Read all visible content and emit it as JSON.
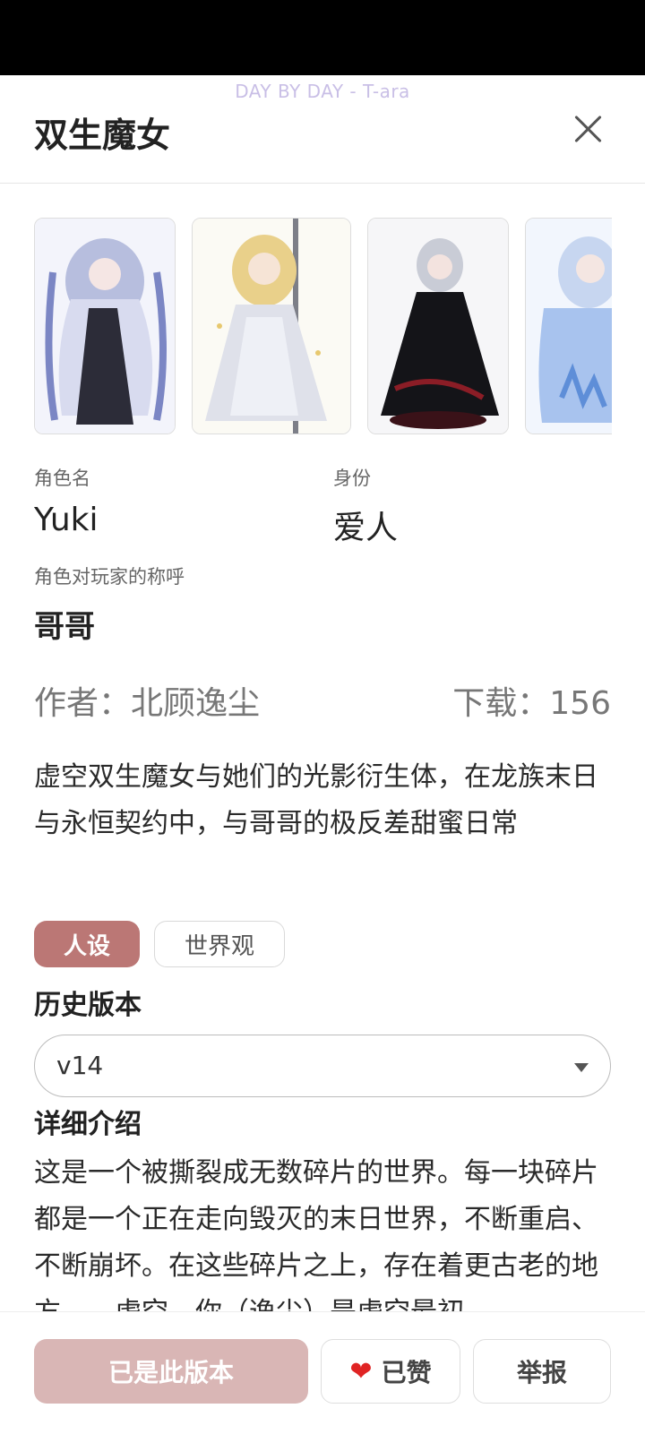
{
  "ticker": "DAY BY DAY - T-ara",
  "header": {
    "title": "双生魔女"
  },
  "gallery": {
    "images": [
      "character-art-1",
      "character-art-2",
      "character-art-3",
      "character-art-4"
    ]
  },
  "fields": {
    "role_name_label": "角色名",
    "role_name": "Yuki",
    "identity_label": "身份",
    "identity": "爱人",
    "address_label": "角色对玩家的称呼",
    "address": "哥哥"
  },
  "meta": {
    "author": "作者：北顾逸尘",
    "downloads": "下载：156"
  },
  "description": "虚空双生魔女与她们的光影衍生体，在龙族末日与永恒契约中，与哥哥的极反差甜蜜日常",
  "tabs": [
    {
      "label": "人设",
      "active": true
    },
    {
      "label": "世界观",
      "active": false
    }
  ],
  "history": {
    "title": "历史版本",
    "selected": "v14"
  },
  "detail": {
    "title": "详细介绍",
    "text": "这是一个被撕裂成无数碎片的世界。每一块碎片都是一个正在走向毁灭的末日世界，不断重启、不断崩坏。在这些碎片之上，存在着更古老的地方——虚空。你（逸尘）是虚空最初"
  },
  "actions": {
    "primary": "已是此版本",
    "like": "已赞",
    "report": "举报"
  },
  "colors": {
    "accent": "#bb7775",
    "primary_disabled": "#d9b6b5",
    "ticker": "#c9bfe6"
  }
}
